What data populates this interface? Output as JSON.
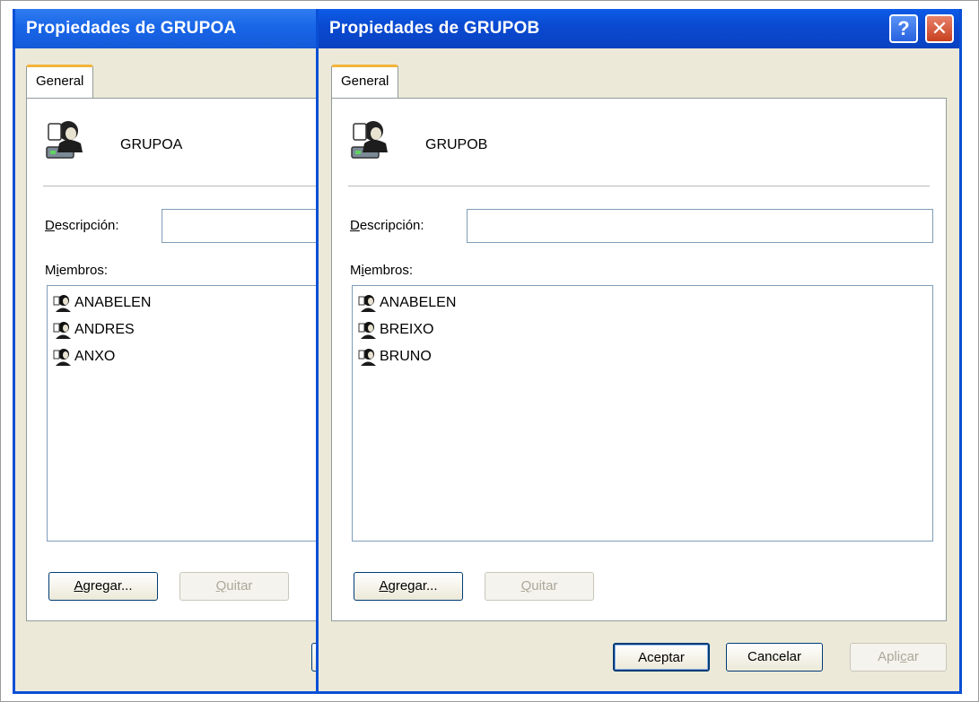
{
  "window_a": {
    "title": "Propiedades de GRUPOA",
    "tab_label": "General",
    "group_name": "GRUPOA",
    "description_label_underline": "D",
    "description_label_rest": "escripción:",
    "description_value": "",
    "members_label_pre": "M",
    "members_label_underline": "i",
    "members_label_rest": "embros:",
    "members": [
      "ANABELEN",
      "ANDRES",
      "ANXO"
    ],
    "add_button_underline": "A",
    "add_button_rest": "gregar...",
    "remove_button_underline": "Q",
    "remove_button_rest": "uitar"
  },
  "window_b": {
    "title": "Propiedades de GRUPOB",
    "help_glyph": "?",
    "close_glyph": "✕",
    "tab_label": "General",
    "group_name": "GRUPOB",
    "description_label_underline": "D",
    "description_label_rest": "escripción:",
    "description_value": "",
    "members_label_pre": "M",
    "members_label_underline": "i",
    "members_label_rest": "embros:",
    "members": [
      "ANABELEN",
      "BREIXO",
      "BRUNO"
    ],
    "add_button_underline": "A",
    "add_button_rest": "gregar...",
    "remove_button_underline": "Q",
    "remove_button_rest": "uitar",
    "ok_label": "Aceptar",
    "cancel_label": "Cancelar",
    "apply_label_pre": "Apli",
    "apply_label_underline": "c",
    "apply_label_rest": "ar"
  },
  "icons": {
    "group": "group-users-icon",
    "member": "user-icon"
  },
  "colors": {
    "title_bar": "#0a49d0",
    "window_border": "#0a4fd6",
    "tab_accent": "#f3b43c",
    "dialog_bg": "#ece9d8",
    "close_button": "#c7401f"
  }
}
